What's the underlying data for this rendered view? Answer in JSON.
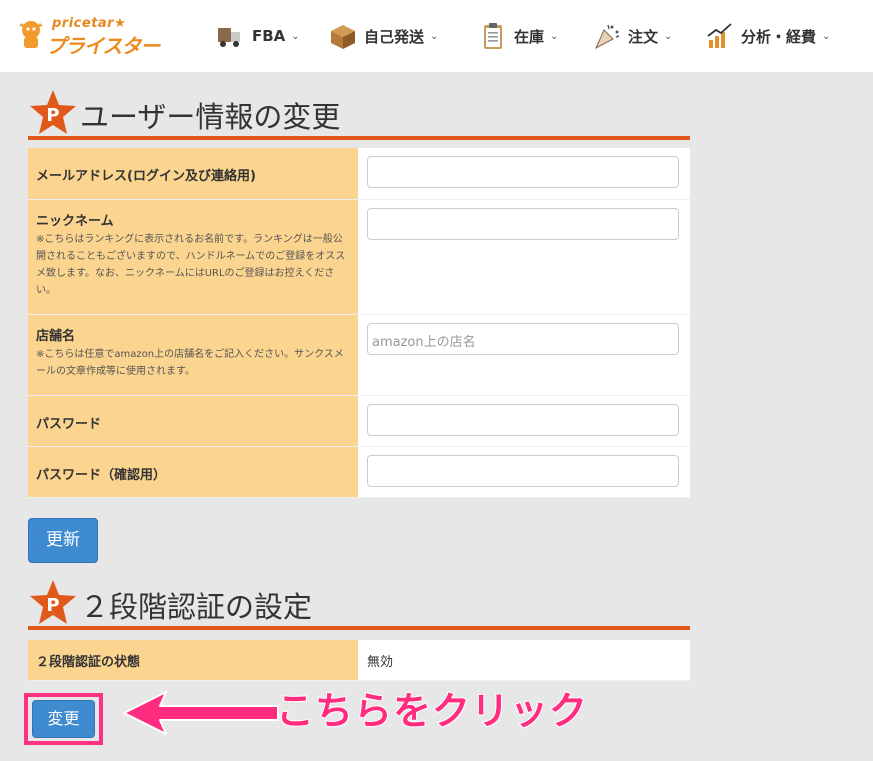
{
  "header": {
    "logo_small": "pricetar★",
    "logo_big": "プライスター",
    "nav": [
      {
        "label": "FBA",
        "icon": "truck-icon"
      },
      {
        "label": "自己発送",
        "icon": "box-icon"
      },
      {
        "label": "在庫",
        "icon": "clipboard-icon"
      },
      {
        "label": "注文",
        "icon": "party-popper-icon"
      },
      {
        "label": "分析・経費",
        "icon": "chart-icon"
      }
    ]
  },
  "user_section": {
    "title": "ユーザー情報の変更",
    "fields": [
      {
        "label": "メールアドレス(ログイン及び連絡用)",
        "note": "",
        "value": "",
        "placeholder": ""
      },
      {
        "label": "ニックネーム",
        "note": "※こちらはランキングに表示されるお名前です。ランキングは一般公開されることもございますので、ハンドルネームでのご登録をオススメ致します。なお、ニックネームにはURLのご登録はお控えください。",
        "value": "",
        "placeholder": ""
      },
      {
        "label": "店舗名",
        "note": "※こちらは任意でamazon上の店舗名をご記入ください。サンクスメールの文章作成等に使用されます。",
        "value": "",
        "placeholder": "amazon上の店名"
      },
      {
        "label": "パスワード",
        "note": "",
        "value": "",
        "placeholder": ""
      },
      {
        "label": "パスワード（確認用）",
        "note": "",
        "value": "",
        "placeholder": ""
      }
    ],
    "update_label": "更新"
  },
  "twofa_section": {
    "title": "２段階認証の設定",
    "status_label": "２段階認証の状態",
    "status_value": "無効",
    "change_label": "変更"
  },
  "annotation": {
    "callout": "こちらをクリック",
    "color": "#ff2c7f"
  },
  "colors": {
    "accent": "#e0591b",
    "label_bg": "#fbd48f",
    "button": "#3f8bd0"
  }
}
